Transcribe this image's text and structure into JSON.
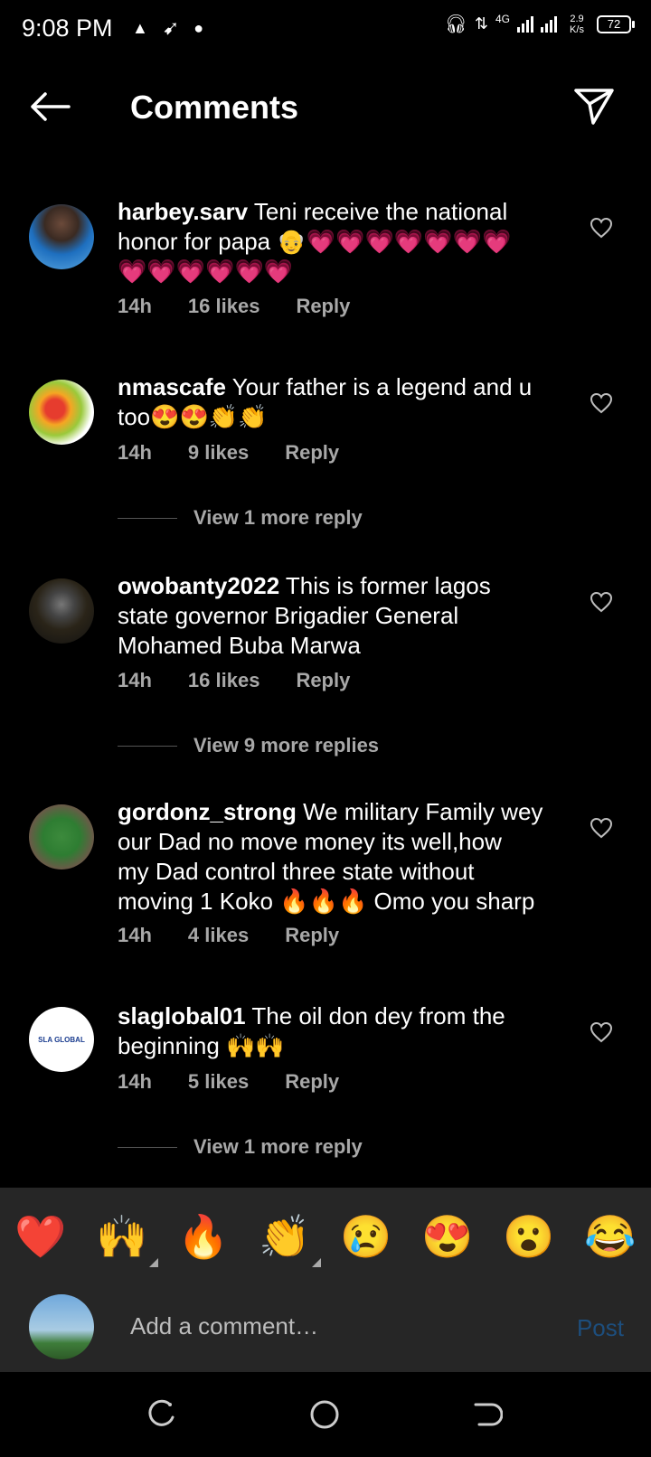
{
  "status": {
    "time": "9:08 PM",
    "net_speed": "2.9",
    "net_unit": "K/s",
    "network": "4G",
    "battery": "72"
  },
  "header": {
    "title": "Comments"
  },
  "comments": [
    {
      "username": "harbey.sarv",
      "text_line1": " Teni receive the national",
      "text_line2": "honor for papa 👴💗💗💗💗💗💗💗",
      "text_line3": "💗💗💗💗💗💗",
      "time": "14h",
      "likes": "16 likes",
      "reply": "Reply"
    },
    {
      "username": "nmascafe",
      "text_line1": " Your father is a legend and u",
      "text_line2": "too😍😍👏👏",
      "time": "14h",
      "likes": "9 likes",
      "reply": "Reply",
      "view_more": "View 1 more reply"
    },
    {
      "username": "owobanty2022",
      "text_line1": " This is former lagos",
      "text_line2": "state governor Brigadier General",
      "text_line3": "Mohamed Buba Marwa",
      "time": "14h",
      "likes": "16 likes",
      "reply": "Reply",
      "view_more": "View 9 more replies"
    },
    {
      "username": "gordonz_strong",
      "text_line1": " We military Family wey",
      "text_line2": "our Dad no move money its well,how",
      "text_line3": "my Dad control three state without",
      "text_line4": "moving 1 Koko 🔥🔥🔥 Omo you sharp",
      "time": "14h",
      "likes": "4 likes",
      "reply": "Reply"
    },
    {
      "username": "slaglobal01",
      "text_line1": " The oil don dey from the",
      "text_line2": "beginning 🙌🙌",
      "time": "14h",
      "likes": "5 likes",
      "reply": "Reply",
      "view_more": "View 1 more reply",
      "avatar_text": "SLA GLOBAL"
    }
  ],
  "reactions": [
    "❤️",
    "🙌",
    "🔥",
    "👏",
    "😢",
    "😍",
    "😮",
    "😂"
  ],
  "composer": {
    "placeholder": "Add a comment…",
    "post": "Post"
  },
  "colors": {
    "background": "#000000",
    "panel": "#262626",
    "muted": "#a8a8a8",
    "post_disabled": "#1d4e7d"
  }
}
